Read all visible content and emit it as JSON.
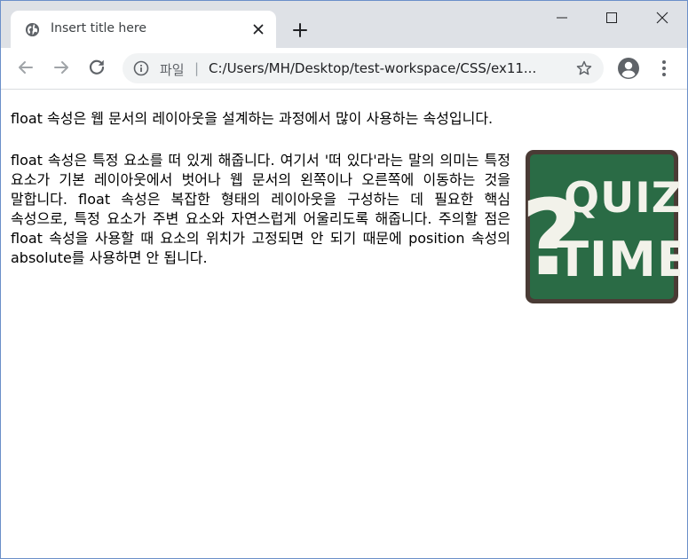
{
  "browser": {
    "tab": {
      "title": "Insert title here",
      "favicon": "globe-icon"
    },
    "security_label": "파일",
    "url": "C:/Users/MH/Desktop/test-workspace/CSS/ex11...",
    "icons": {
      "back": "arrow-left-icon",
      "forward": "arrow-right-icon",
      "reload": "reload-icon",
      "info": "info-icon",
      "bookmark": "star-icon",
      "profile": "account-circle-icon",
      "menu": "three-dot-menu-icon",
      "new_tab": "plus-icon",
      "close_tab": "close-icon",
      "minimize": "minimize-icon",
      "maximize": "maximize-icon",
      "close_window": "close-icon"
    }
  },
  "page": {
    "paragraph1": "float 속성은 웹 문서의 레이아웃을 설계하는 과정에서 많이 사용하는 속성입니다.",
    "paragraph2": "float 속성은 특정 요소를 떠 있게 해줍니다. 여기서 '떠 있다'라는 말의 의미는 특정 요소가 기본 레이아웃에서 벗어나 웹 문서의 왼쪽이나 오른쪽에 이동하는 것을 말합니다. float 속성은 복잡한 형태의 레이아웃을 구성하는 데 필요한 핵심 속성으로, 특정 요소가 주변 요소와 자연스럽게 어울리도록 해줍니다. 주의할 점은 float 속성을 사용할 때 요소의 위치가 고정되면 안 되기 때문에 position 속성의 absolute를 사용하면 안 됩니다.",
    "image": {
      "line1": "QUIZ",
      "line2": "TIME",
      "mark": "?",
      "board_color": "#2a6b45",
      "frame_color": "#4a3b35",
      "chalk_color": "#f2f2ea"
    }
  }
}
